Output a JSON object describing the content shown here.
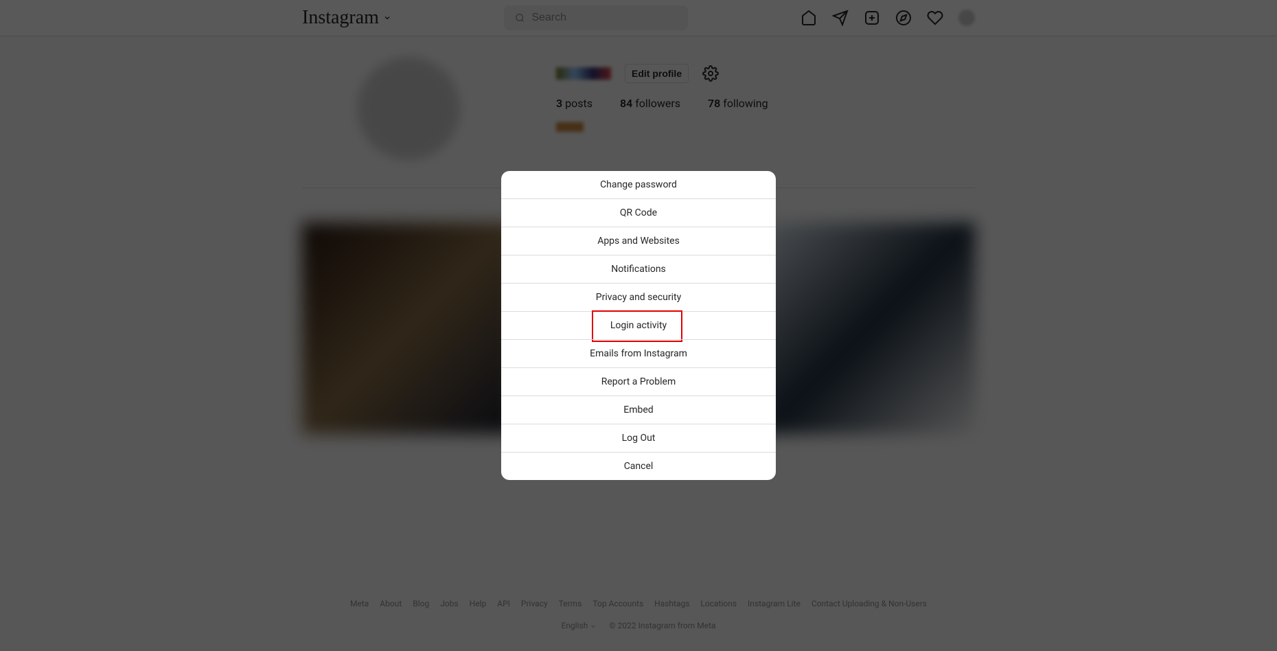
{
  "nav": {
    "logo": "Instagram",
    "search_placeholder": "Search"
  },
  "profile": {
    "edit_label": "Edit profile",
    "posts_count": "3",
    "posts_label": "posts",
    "followers_count": "84",
    "followers_label": "followers",
    "following_count": "78",
    "following_label": "following"
  },
  "modal": {
    "items": [
      "Change password",
      "QR Code",
      "Apps and Websites",
      "Notifications",
      "Privacy and security",
      "Login activity",
      "Emails from Instagram",
      "Report a Problem",
      "Embed",
      "Log Out",
      "Cancel"
    ],
    "highlighted_index": 5
  },
  "footer": {
    "links": [
      "Meta",
      "About",
      "Blog",
      "Jobs",
      "Help",
      "API",
      "Privacy",
      "Terms",
      "Top Accounts",
      "Hashtags",
      "Locations",
      "Instagram Lite",
      "Contact Uploading & Non-Users"
    ],
    "language": "English",
    "copyright": "© 2022 Instagram from Meta"
  }
}
